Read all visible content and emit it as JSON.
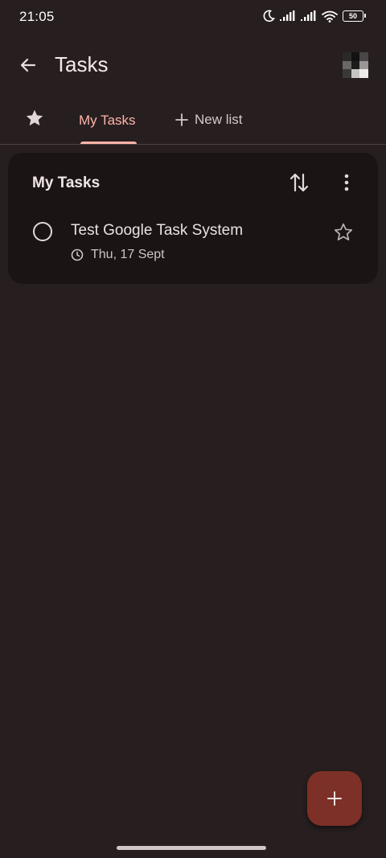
{
  "status_bar": {
    "time": "21:05",
    "battery": "50",
    "icons": [
      "moon-icon",
      "signal-icon",
      "signal-icon",
      "wifi-icon",
      "battery-icon"
    ]
  },
  "app_bar": {
    "title": "Tasks",
    "back_icon": "arrow-left-icon",
    "avatar_icon": "avatar"
  },
  "tabs": {
    "starred_icon": "star-filled-icon",
    "active_tab": "My Tasks",
    "new_list_label": "New list",
    "new_list_icon": "plus-icon"
  },
  "list_card": {
    "title": "My Tasks",
    "sort_icon": "sort-arrows-icon",
    "more_icon": "more-vertical-icon",
    "tasks": [
      {
        "title": "Test Google Task System",
        "due": "Thu, 17 Sept",
        "starred": false
      }
    ]
  },
  "fab": {
    "icon": "plus-icon"
  },
  "colors": {
    "background": "#261e1f",
    "card": "#1b1414",
    "accent": "#ffb4a9",
    "fab": "#7d3027"
  }
}
